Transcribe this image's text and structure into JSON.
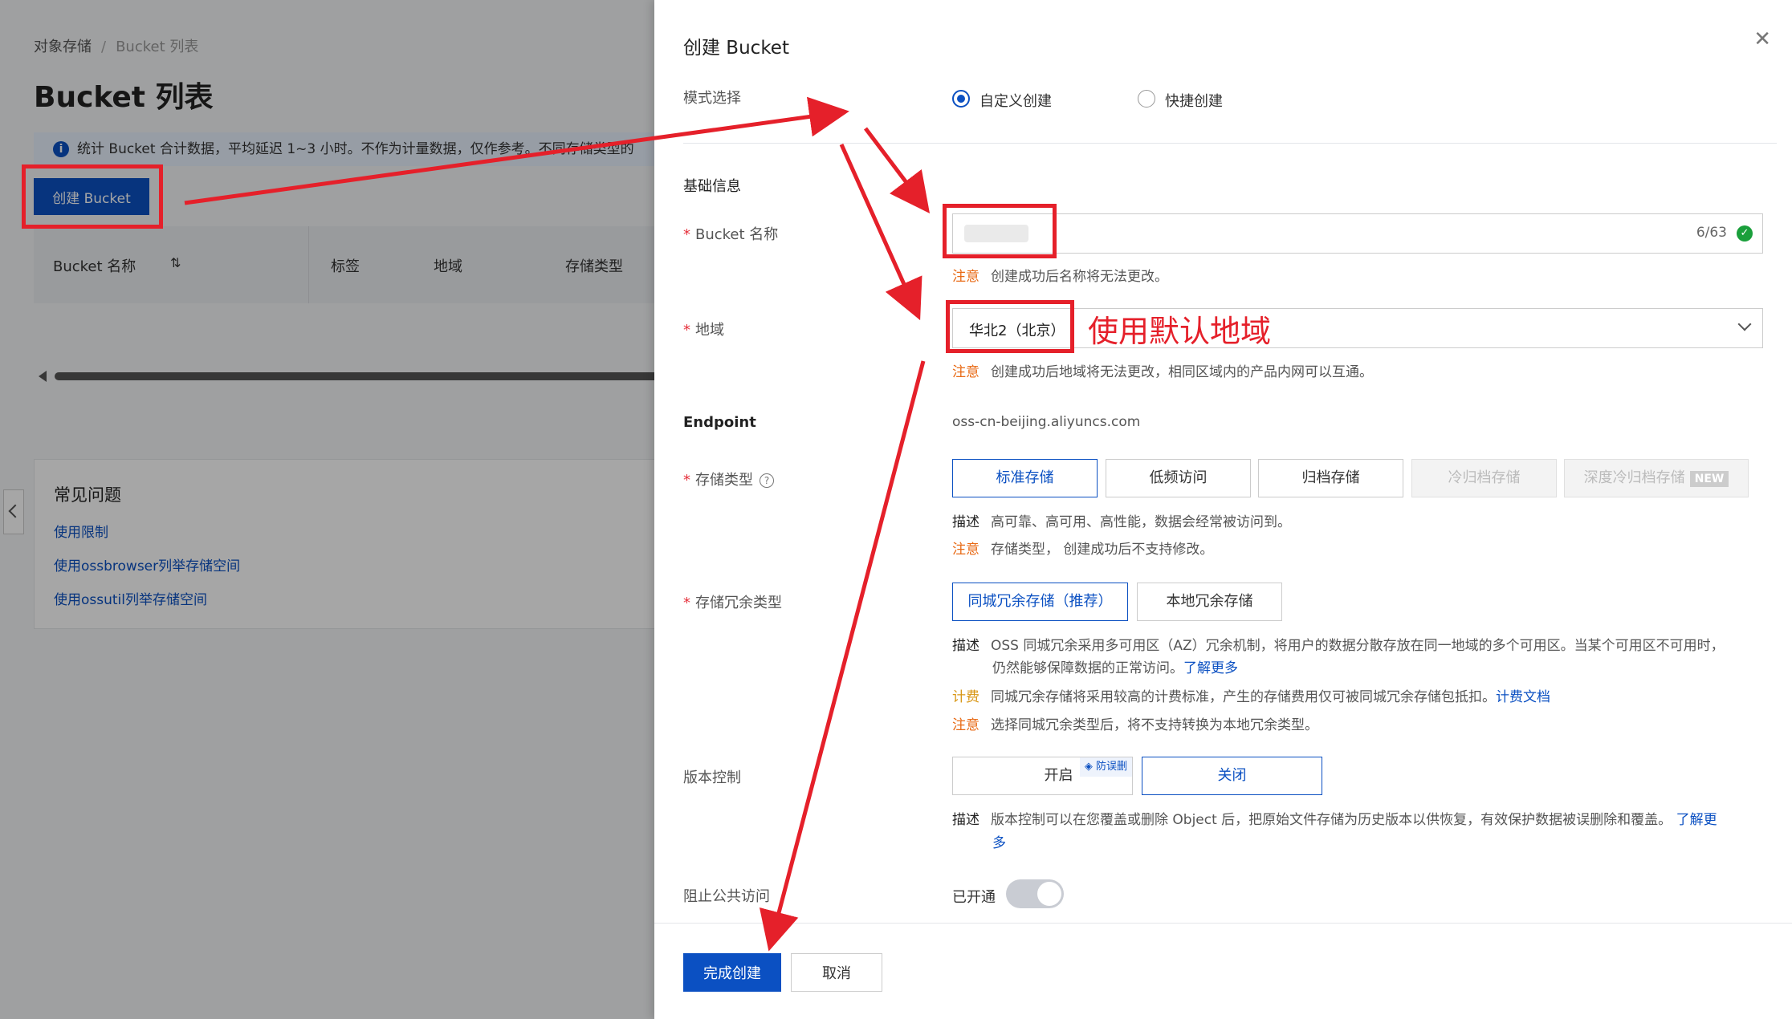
{
  "background": {
    "breadcrumb": {
      "root": "对象存储",
      "current": "Bucket 列表"
    },
    "page_title": "Bucket 列表",
    "notice": "统计 Bucket 合计数据，平均延迟 1~3 小时。不作为计量数据，仅作参考。不同存储类型的",
    "create_button": "创建 Bucket",
    "table_columns": [
      "Bucket 名称",
      "标签",
      "地域",
      "存储类型"
    ],
    "faq": {
      "title": "常见问题",
      "links": [
        "使用限制",
        "使用ossbrowser列举存储空间",
        "使用ossutil列举存储空间"
      ]
    }
  },
  "drawer": {
    "title": "创建 Bucket",
    "mode": {
      "label": "模式选择",
      "options": [
        "自定义创建",
        "快捷创建"
      ],
      "selected": "自定义创建"
    },
    "section_basic": "基础信息",
    "bucket_name": {
      "label": "Bucket 名称",
      "counter": "6/63",
      "note_key": "注意",
      "note": "创建成功后名称将无法更改。"
    },
    "region": {
      "label": "地域",
      "value": "华北2（北京）",
      "note_key": "注意",
      "note": "创建成功后地域将无法更改，相同区域内的产品内网可以互通。"
    },
    "endpoint": {
      "label": "Endpoint",
      "value": "oss-cn-beijing.aliyuncs.com"
    },
    "storage_class": {
      "label": "存储类型",
      "options": [
        "标准存储",
        "低频访问",
        "归档存储",
        "冷归档存储",
        "深度冷归档存储"
      ],
      "new_tag": "NEW",
      "selected": "标准存储",
      "desc_key": "描述",
      "desc": "高可靠、高可用、高性能，数据会经常被访问到。",
      "note_key": "注意",
      "note": "存储类型， 创建成功后不支持修改。"
    },
    "redundancy": {
      "label": "存储冗余类型",
      "options": [
        "同城冗余存储（推荐）",
        "本地冗余存储"
      ],
      "selected": "同城冗余存储（推荐）",
      "desc_key": "描述",
      "desc_line1": "OSS 同城冗余采用多可用区（AZ）冗余机制，将用户的数据分散存放在同一地域的多个可用区。当某个可用区不可用时，",
      "desc_line2": "仍然能够保障数据的正常访问。",
      "desc_link": "了解更多",
      "cost_key": "计费",
      "cost": "同城冗余存储将采用较高的计费标准，产生的存储费用仅可被同城冗余存储包抵扣。",
      "cost_link": "计费文档",
      "note_key": "注意",
      "note": "选择同城冗余类型后，将不支持转换为本地冗余类型。"
    },
    "versioning": {
      "label": "版本控制",
      "options": [
        "开启",
        "关闭"
      ],
      "protect_tag": "防误删",
      "selected": "关闭",
      "desc_key": "描述",
      "desc": "版本控制可以在您覆盖或删除 Object 后，把原始文件存储为历史版本以供恢复，有效保护数据被误删除和覆盖。",
      "link_a": "了解更",
      "link_b": "多"
    },
    "block_public": {
      "label": "阻止公共访问",
      "state": "已开通"
    },
    "confirm_button": "完成创建",
    "cancel_button": "取消"
  },
  "annotation": {
    "text": "使用默认地域",
    "color": "#e5202a"
  },
  "colors": {
    "primary": "#0b50c2",
    "warning": "#e86a15",
    "cost": "#d89614",
    "annotation": "#e5202a"
  }
}
